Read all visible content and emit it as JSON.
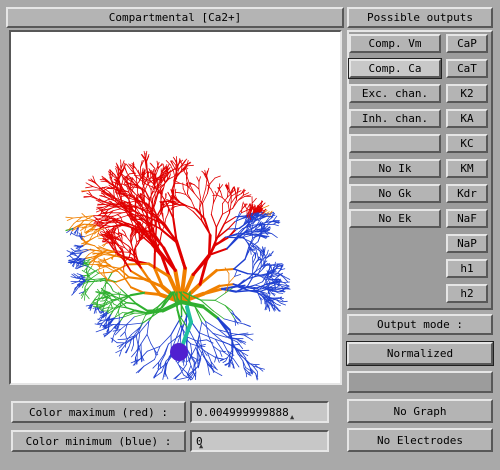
{
  "title": "Compartmental [Ca2+]",
  "outputs": {
    "header": "Possible outputs",
    "left_buttons": [
      "Comp. Vm",
      "Comp. Ca",
      "Exc. chan.",
      "Inh. chan.",
      "",
      "No Ik",
      "No Gk",
      "No Ek"
    ],
    "right_buttons": [
      "CaP",
      "CaT",
      "K2",
      "KA",
      "KC",
      "KM",
      "Kdr",
      "NaF",
      "NaP",
      "h1",
      "h2"
    ]
  },
  "output_mode": {
    "label": "Output mode :",
    "value": "Normalized"
  },
  "color_max": {
    "label": "Color maximum (red)  :",
    "value": "0.004999999888"
  },
  "color_min": {
    "label": "Color minimum (blue) :",
    "value": "0"
  },
  "graph_button": "No Graph",
  "electrodes_button": "No Electrodes",
  "colors": {
    "hot": "#e00000",
    "warm": "#f08000",
    "mid": "#30b030",
    "cool": "#2040d0",
    "soma": "#5020d0",
    "axon": "#20c0a0"
  }
}
